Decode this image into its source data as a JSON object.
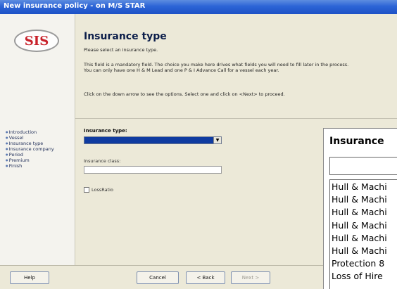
{
  "window": {
    "title": "New insurance policy - on M/S STAR"
  },
  "logo": {
    "text": "SIS",
    "color": "#c8202a"
  },
  "steps": [
    "Introduction",
    "Vessel",
    "Insurance type",
    "Insurance company",
    "Period",
    "Premium",
    "Finish"
  ],
  "main": {
    "heading": "Insurance type",
    "subtitle": "Please select an insurance type.",
    "desc1": "This field is a mandatory field. The choice you make here drives what fields you will need to fill later in the process.",
    "desc2": "You can only have one H & M Lead and one P & I Advance Call for a vessel each year.",
    "hint": "Click on the down arrow to see the options. Select one and click on <Next> to proceed.",
    "type_label": "Insurance type:",
    "type_value": "",
    "class_label": "Insurance class:",
    "class_value": "",
    "loss_label": "LossRatio"
  },
  "buttons": {
    "help": "Help",
    "cancel": "Cancel",
    "back": "< Back",
    "next": "Next >"
  },
  "zoom": {
    "title": "Insurance",
    "field_value": "",
    "options": [
      "Hull & Machi",
      "Hull & Machi",
      "Hull & Machi",
      "Hull & Machi",
      "Hull & Machi",
      "Hull & Machi",
      "Protection 8",
      "Loss of Hire"
    ]
  },
  "colors": {
    "titlebar": "#2c64d6",
    "selected_field": "#0f3ba0"
  }
}
